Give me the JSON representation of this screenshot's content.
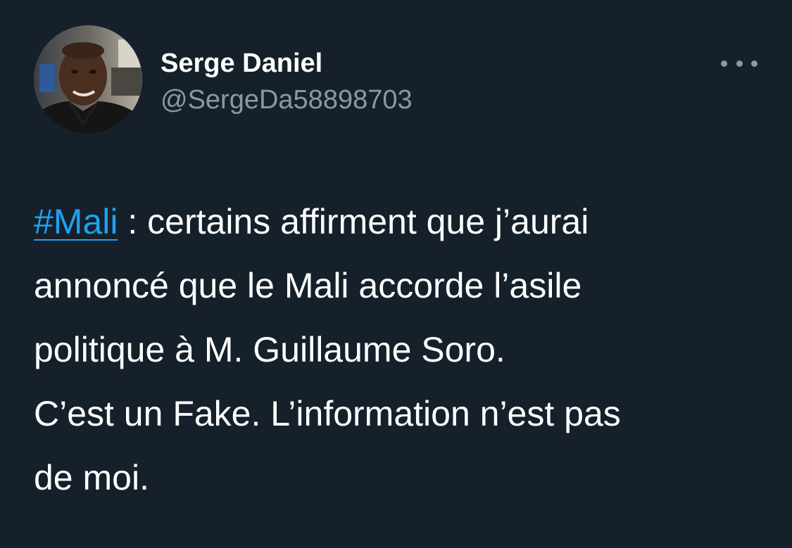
{
  "tweet": {
    "author": {
      "name": "Serge Daniel",
      "handle": "@SergeDa58898703"
    },
    "more_icon": "more-dots-icon",
    "text": {
      "hashtag": "#Mali",
      "line1_rest": " : certains affirment que j’aurai",
      "line2": "annoncé que le Mali accorde l’asile",
      "line3": "politique à M. Guillaume Soro.",
      "line4": "C’est un Fake. L’information n’est pas",
      "line5": "de moi."
    }
  },
  "colors": {
    "background": "#15202b",
    "primary_text": "#ffffff",
    "secondary_text": "#8899a6",
    "link": "#1da1f2"
  }
}
